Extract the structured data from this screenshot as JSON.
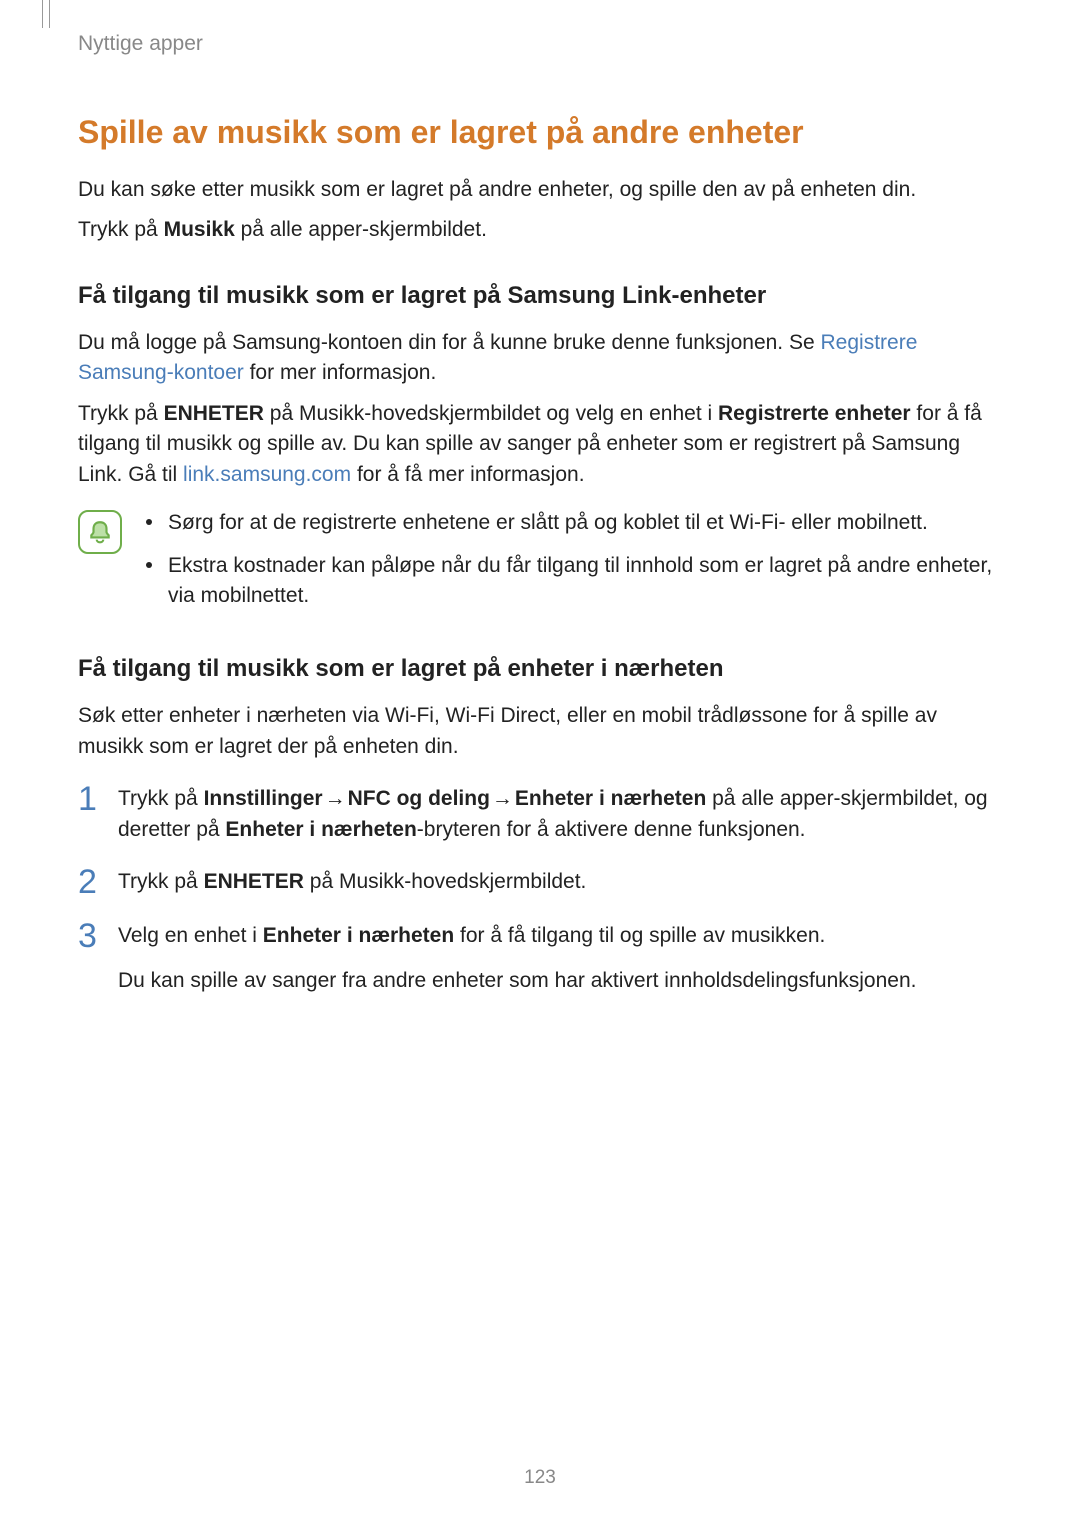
{
  "breadcrumb": "Nyttige apper",
  "h1": "Spille av musikk som er lagret på andre enheter",
  "intro1": "Du kan søke etter musikk som er lagret på andre enheter, og spille den av på enheten din.",
  "intro2_pre": "Trykk på ",
  "intro2_bold": "Musikk",
  "intro2_post": " på alle apper-skjermbildet.",
  "section1": {
    "heading": "Få tilgang til musikk som er lagret på Samsung Link-enheter",
    "p1_pre": "Du må logge på Samsung-kontoen din for å kunne bruke denne funksjonen. Se ",
    "p1_link": "Registrere Samsung-kontoer",
    "p1_post": " for mer informasjon.",
    "p2_a": "Trykk på ",
    "p2_b": "ENHETER",
    "p2_c": " på Musikk-hovedskjermbildet og velg en enhet i ",
    "p2_d": "Registrerte enheter",
    "p2_e": " for å få tilgang til musikk og spille av. Du kan spille av sanger på enheter som er registrert på Samsung Link. Gå til ",
    "p2_link": "link.samsung.com",
    "p2_f": " for å få mer informasjon.",
    "bullet1": "Sørg for at de registrerte enhetene er slått på og koblet til et Wi-Fi- eller mobilnett.",
    "bullet2": "Ekstra kostnader kan påløpe når du får tilgang til innhold som er lagret på andre enheter, via mobilnettet."
  },
  "section2": {
    "heading": "Få tilgang til musikk som er lagret på enheter i nærheten",
    "p1": "Søk etter enheter i nærheten via Wi-Fi, Wi-Fi Direct, eller en mobil trådløssone for å spille av musikk som er lagret der på enheten din.",
    "step1": {
      "num": "1",
      "a": "Trykk på ",
      "b": "Innstillinger",
      "arrow1": "→",
      "c": "NFC og deling",
      "arrow2": "→",
      "d": "Enheter i nærheten",
      "e": " på alle apper-skjermbildet, og deretter på ",
      "f": "Enheter i nærheten",
      "g": "-bryteren for å aktivere denne funksjonen."
    },
    "step2": {
      "num": "2",
      "a": "Trykk på ",
      "b": "ENHETER",
      "c": " på Musikk-hovedskjermbildet."
    },
    "step3": {
      "num": "3",
      "a": "Velg en enhet i ",
      "b": "Enheter i nærheten",
      "c": " for å få tilgang til og spille av musikken.",
      "sub": "Du kan spille av sanger fra andre enheter som har aktivert innholdsdelingsfunksjonen."
    }
  },
  "pageNumber": "123"
}
